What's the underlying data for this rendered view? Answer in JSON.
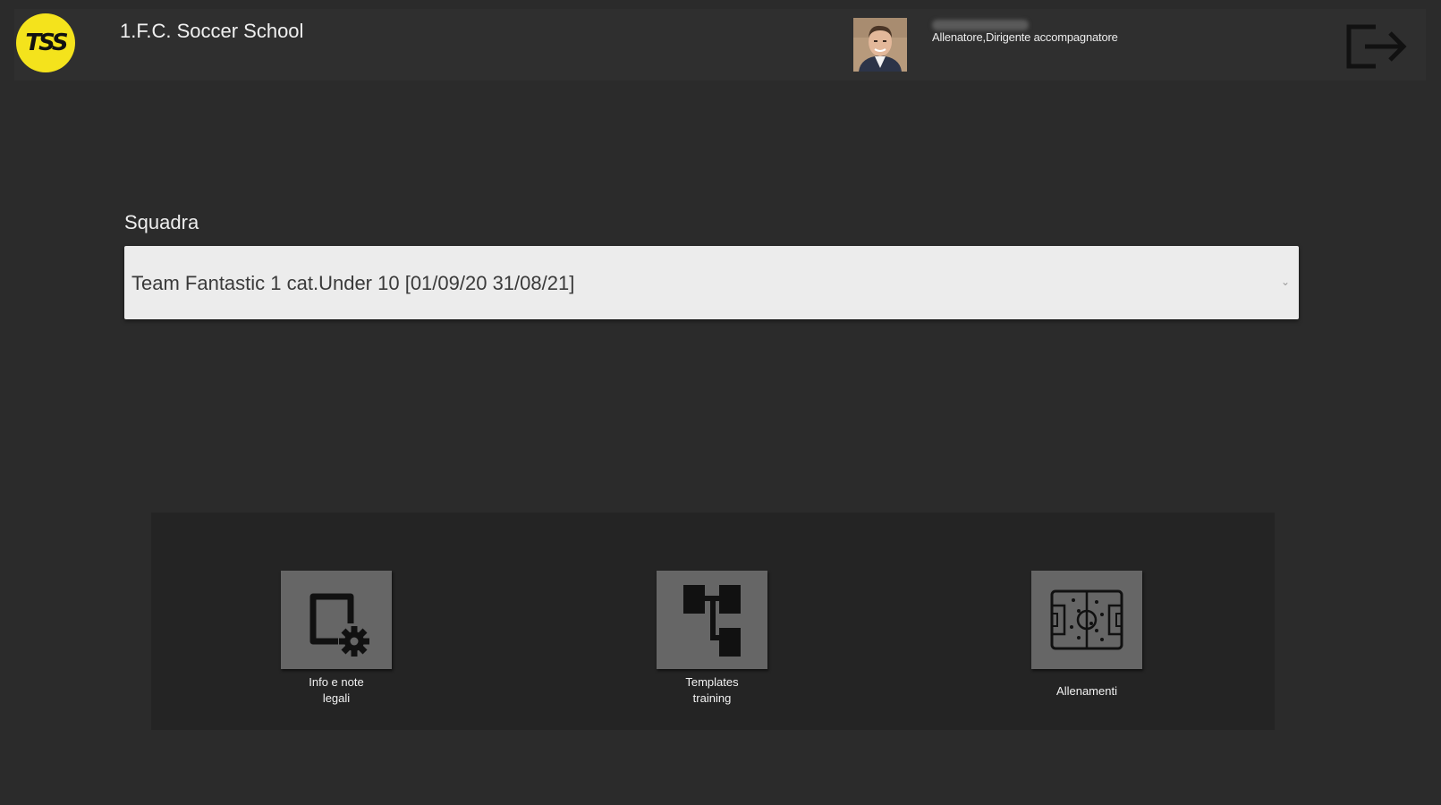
{
  "header": {
    "logo_text": "TSS",
    "app_title": "1.F.C. Soccer School",
    "user_role": "Allenatore,Dirigente accompagnatore",
    "logout_icon": "logout-icon"
  },
  "team": {
    "label": "Squadra",
    "selected": "Team Fantastic 1 cat.Under 10 [01/09/20 31/08/21]",
    "caret": "⌄"
  },
  "menu": {
    "items": [
      {
        "label": "Info e note\nlegali",
        "icon": "screen-settings-icon"
      },
      {
        "label": "Templates\ntraining",
        "icon": "hierarchy-icon"
      },
      {
        "label": "Allenamenti",
        "icon": "soccer-field-icon"
      }
    ]
  },
  "colors": {
    "background": "#2b2b2b",
    "topbar": "#2f2f2f",
    "logo": "#f4e31c",
    "tile": "#666666",
    "select": "#ececec"
  }
}
